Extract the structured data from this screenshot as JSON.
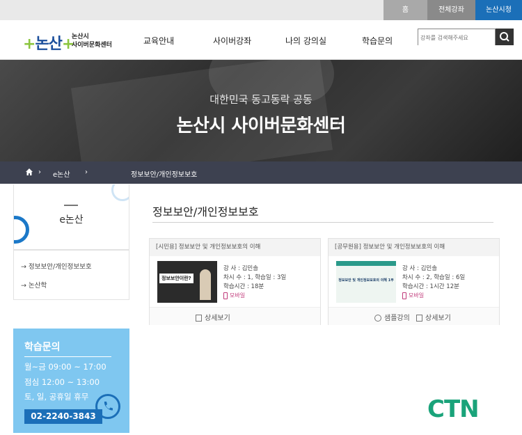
{
  "topbar": {
    "home": "홈",
    "all_courses": "전체강좌",
    "apply": "논산시청"
  },
  "logo": {
    "mark": "논산",
    "name_line1": "논산시",
    "name_line2": "사이버문화센터"
  },
  "nav": [
    "교육안내",
    "사이버강좌",
    "나의 강의실",
    "학습문의"
  ],
  "search": {
    "placeholder": "강좌를 검색해주세요"
  },
  "hero": {
    "subtitle": "대한민국 동고동락 공동",
    "title": "논산시 사이버문화센터"
  },
  "breadcrumb": {
    "sep": "›",
    "level1": "e논산",
    "current": "정보보안/개인정보보호"
  },
  "sidebar": {
    "title": "e논산",
    "menu": [
      "정보보안/개인정보보호",
      "논산학"
    ],
    "arrow": "→",
    "inquiry": {
      "title": "학습문의",
      "lines": [
        "월~금 09:00 ~ 17:00",
        "점심 12:00 ~ 13:00",
        "토, 일, 공휴일 휴무"
      ],
      "phone": "02-2240-3843"
    }
  },
  "main": {
    "title": "정보보안/개인정보보호",
    "cards": [
      {
        "heading": "[시민용] 정보보안 및 개인정보보호의 이해",
        "thumb_label": "정보보안이란?",
        "instructor": "강 사 : 김민솔",
        "sessions": "차시 수 : 1, 학습일 : 3일",
        "duration": "학습시간 : 18분",
        "mobile": "모바일",
        "detail": "상세보기"
      },
      {
        "heading": "[공무원용] 정보보안 및 개인정보보호의 이해",
        "thumb_label": "정보보안 및 개인정보보호의 이해 1부",
        "instructor": "강 사 : 김민솔",
        "sessions": "차시 수 : 2, 학습일 : 6일",
        "duration": "학습시간 : 1시간 12분",
        "mobile": "모바일",
        "sample": "샘플강의",
        "detail": "상세보기"
      }
    ]
  },
  "watermark": "CTN",
  "colors": {
    "brand_blue": "#1b6fb8",
    "sidebar_blue": "#7fc7f0",
    "crumb_bg": "#3d4150",
    "ctn_green": "#1aa37a"
  }
}
